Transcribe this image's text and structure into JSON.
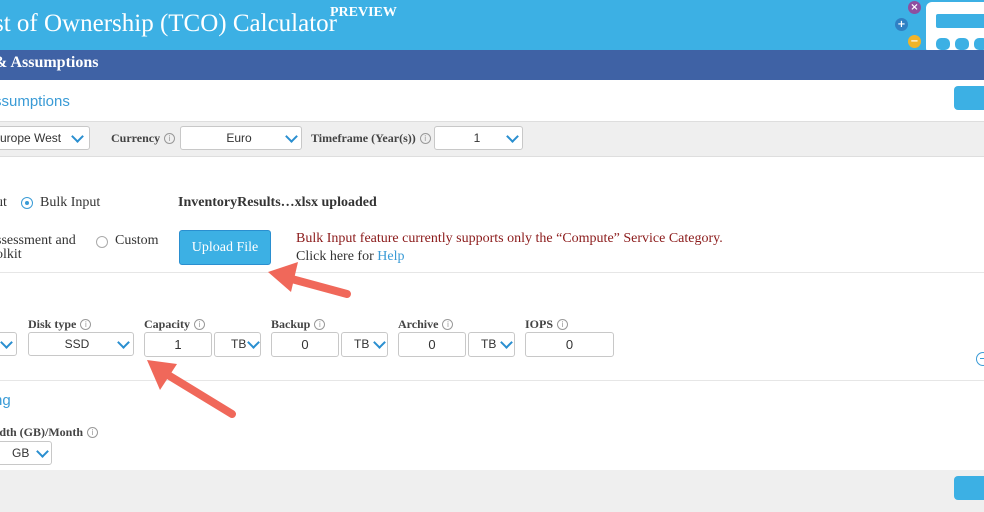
{
  "header": {
    "title": "st of Ownership (TCO) Calculator",
    "badge": "PREVIEW",
    "close_glyph": "×",
    "add_glyph": "+",
    "minus_glyph": "−",
    "icon": "calculator-icon"
  },
  "section": {
    "title": "& Assumptions",
    "subtitle_link": "ssumptions"
  },
  "filters": {
    "region_value": "urope West",
    "currency_label": "Currency",
    "currency_value": "Euro",
    "timeframe_label": "Timeframe (Year(s))",
    "timeframe_value": "1"
  },
  "input_options": {
    "opt1_fragment": "ut",
    "bulk_input_label": "Bulk Input",
    "uploaded_text": "InventoryResults…xlsx uploaded",
    "assess_line1": "ssessment and",
    "assess_line2": "olkit",
    "custom_label": "Custom",
    "upload_button": "Upload File",
    "notice": "Bulk Input feature currently supports only the “Compute” Service Category.",
    "help_prefix": "Click here for ",
    "help_link": "Help"
  },
  "storage": {
    "disk_type_label": "Disk type",
    "disk_type_value": "SSD",
    "capacity_label": "Capacity",
    "capacity_value": "1",
    "capacity_unit": "TB",
    "backup_label": "Backup",
    "backup_value": "0",
    "backup_unit": "TB",
    "archive_label": "Archive",
    "archive_value": "0",
    "archive_unit": "TB",
    "iops_label": "IOPS",
    "iops_value": "0"
  },
  "networking": {
    "title": "ng",
    "bandwidth_label": "idth (GB)/Month",
    "bandwidth_unit": "GB"
  },
  "info_glyph": "i",
  "colors": {
    "header": "#3cb0e4",
    "section_bar": "#3f62a5",
    "link": "#3a9bd6",
    "notice": "#8b1a1a",
    "arrow": "#f0685a"
  }
}
